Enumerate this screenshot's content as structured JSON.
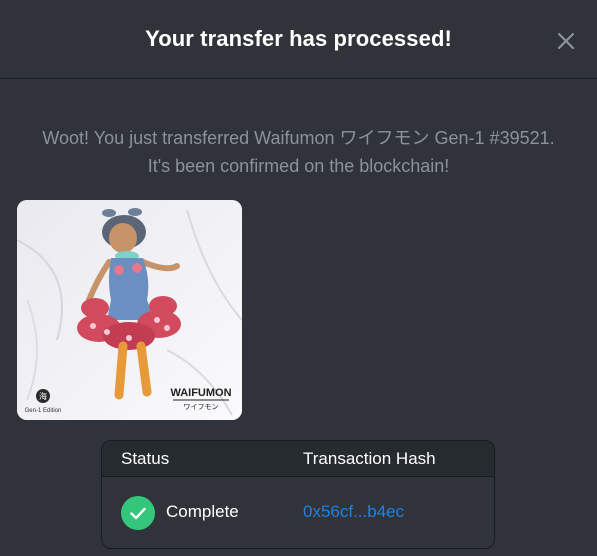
{
  "modal": {
    "title": "Your transfer has processed!",
    "close_icon": "close-icon",
    "message_line1": "Woot! You just transferred Waifumon ワイフモン Gen-1 #39521.",
    "message_line2": "It's been confirmed on the blockchain!"
  },
  "nft": {
    "brand": "WAIFUMON",
    "brand_sub": "ワイフモン",
    "edition": "Gen-1 Edition",
    "seal_char": "海"
  },
  "transaction_table": {
    "headers": {
      "status": "Status",
      "hash": "Transaction Hash"
    },
    "row": {
      "status_icon": "check-circle-icon",
      "status": "Complete",
      "hash": "0x56cf...b4ec"
    }
  },
  "colors": {
    "background": "#303339",
    "success": "#34c77b",
    "link": "#2081e2",
    "muted_text": "#8a939b"
  }
}
